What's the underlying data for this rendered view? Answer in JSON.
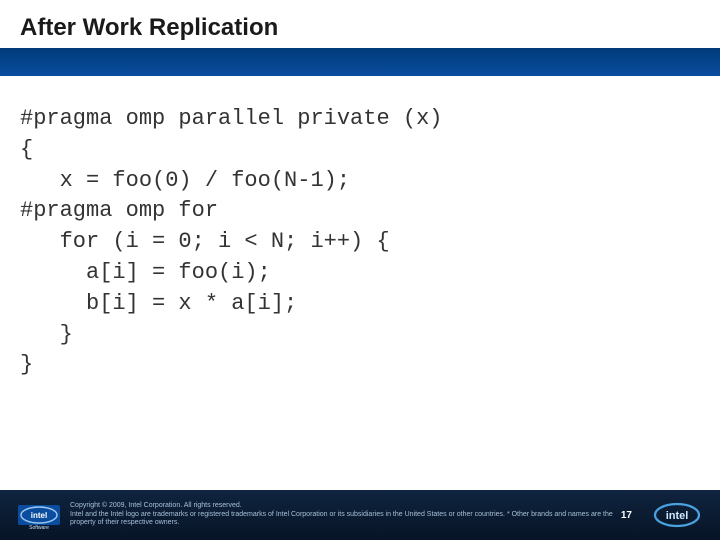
{
  "slide": {
    "title": "After Work Replication",
    "code": "#pragma omp parallel private (x)\n{\n   x = foo(0) / foo(N-1);\n#pragma omp for\n   for (i = 0; i < N; i++) {\n     a[i] = foo(i);\n     b[i] = x * a[i];\n   }\n}",
    "page_number": "17"
  },
  "footer": {
    "copyright": "Copyright © 2009, Intel Corporation. All rights reserved.",
    "trademark": "Intel and the Intel logo are trademarks or registered trademarks of Intel Corporation or its subsidiaries in the United States or other countries. * Other brands and names are the property of their respective owners."
  },
  "brand": {
    "left_logo_label": "Intel Software",
    "right_logo_label": "Intel"
  }
}
